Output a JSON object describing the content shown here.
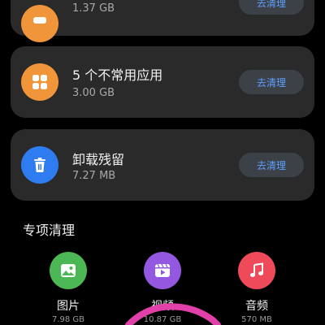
{
  "colors": {
    "orange": "#f0953a",
    "blue": "#2f7cf0",
    "green": "#4cb855",
    "purple": "#9457e0",
    "red": "#ee4a59",
    "link": "#5ea0ff",
    "highlight": "#e040a8"
  },
  "cards": [
    {
      "title": "",
      "size": "1.37 GB",
      "button": "去清理",
      "icon": "grid-icon"
    },
    {
      "title": "5 个不常用应用",
      "size": "3.00 GB",
      "button": "去清理",
      "icon": "apps-grid-icon"
    },
    {
      "title": "卸载残留",
      "size": "7.27 MB",
      "button": "去清理",
      "icon": "trash-icon"
    }
  ],
  "section": {
    "title": "专项清理"
  },
  "specials": [
    {
      "label": "图片",
      "size": "7.98 GB",
      "icon": "image-icon"
    },
    {
      "label": "视频",
      "size": "10.87 GB",
      "icon": "video-icon"
    },
    {
      "label": "音频",
      "size": "570 MB",
      "icon": "music-note-icon"
    }
  ]
}
